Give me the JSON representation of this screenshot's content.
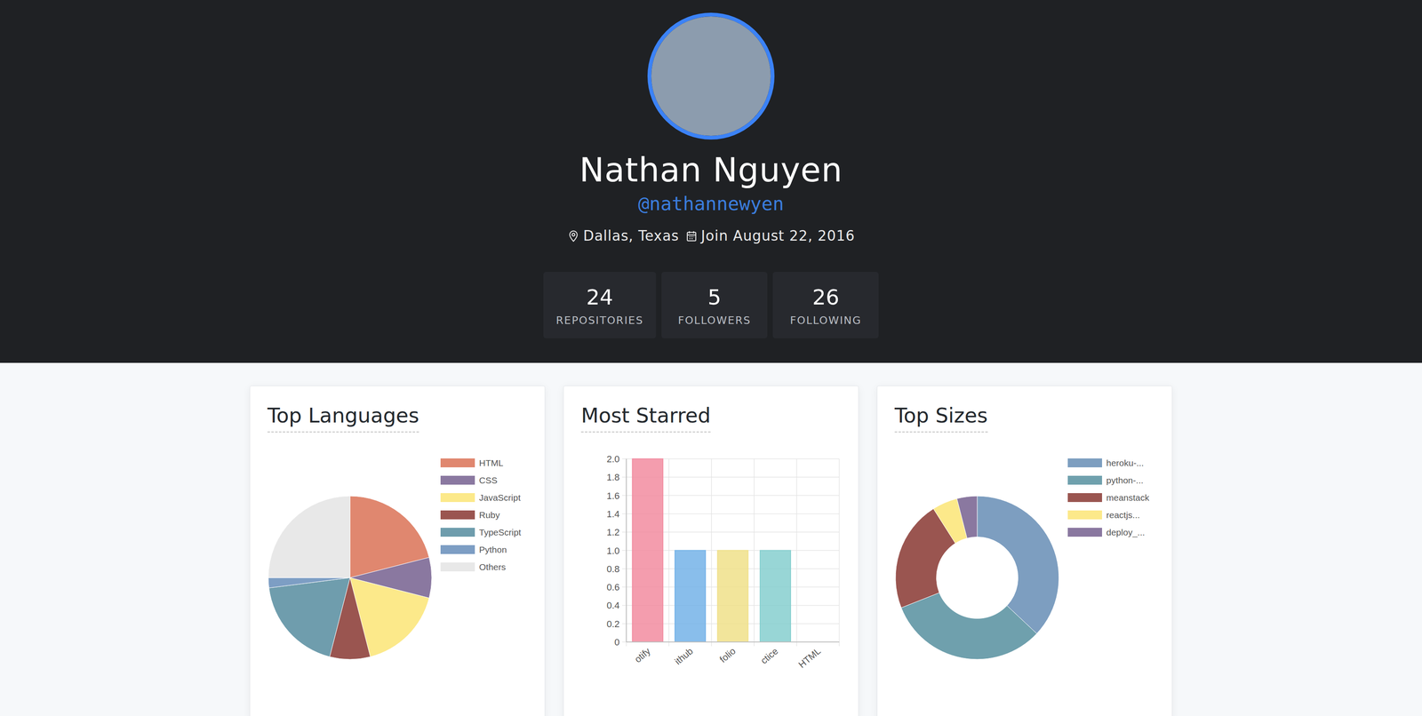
{
  "profile": {
    "name": "Nathan Nguyen",
    "handle": "@nathannewyen",
    "location": "Dallas, Texas",
    "joined": "Join August 22, 2016"
  },
  "stats": [
    {
      "value": "24",
      "label": "REPOSITORIES"
    },
    {
      "value": "5",
      "label": "FOLLOWERS"
    },
    {
      "value": "26",
      "label": "FOLLOWING"
    }
  ],
  "languages": {
    "title": "Top Languages",
    "slices": [
      {
        "label": "HTML",
        "value": 21,
        "color": "#e0876f"
      },
      {
        "label": "CSS",
        "value": 8,
        "color": "#8a78a0"
      },
      {
        "label": "JavaScript",
        "value": 17,
        "color": "#fce98a"
      },
      {
        "label": "Ruby",
        "value": 8,
        "color": "#9a5550"
      },
      {
        "label": "TypeScript",
        "value": 19,
        "color": "#6f9dad"
      },
      {
        "label": "Python",
        "value": 2,
        "color": "#7d9ec4"
      },
      {
        "label": "Others",
        "value": 25,
        "color": "#e8e8e8"
      }
    ]
  },
  "starred": {
    "title": "Most Starred",
    "ticks": [
      "2.0",
      "1.8",
      "1.6",
      "1.4",
      "1.2",
      "1.0",
      "0.8",
      "0.6",
      "0.4",
      "0.2",
      "0"
    ],
    "bars": [
      {
        "label": "otify",
        "value": 2,
        "color": "#f28ca0"
      },
      {
        "label": "ithub",
        "value": 1,
        "color": "#74b3e8"
      },
      {
        "label": "folio",
        "value": 1,
        "color": "#f0e08a"
      },
      {
        "label": "ctice",
        "value": 1,
        "color": "#86cfcf"
      },
      {
        "label": "HTML",
        "value": 0,
        "color": "#b39ddb"
      }
    ]
  },
  "sizes": {
    "title": "Top Sizes",
    "slices": [
      {
        "label": "heroku-...",
        "value": 37,
        "color": "#7d9ec0"
      },
      {
        "label": "python-...",
        "value": 32,
        "color": "#6fa0ad"
      },
      {
        "label": "meanstack",
        "value": 22,
        "color": "#9a5550"
      },
      {
        "label": "reactjs...",
        "value": 5,
        "color": "#fce98a"
      },
      {
        "label": "deploy_...",
        "value": 4,
        "color": "#8a78a0"
      }
    ]
  }
}
